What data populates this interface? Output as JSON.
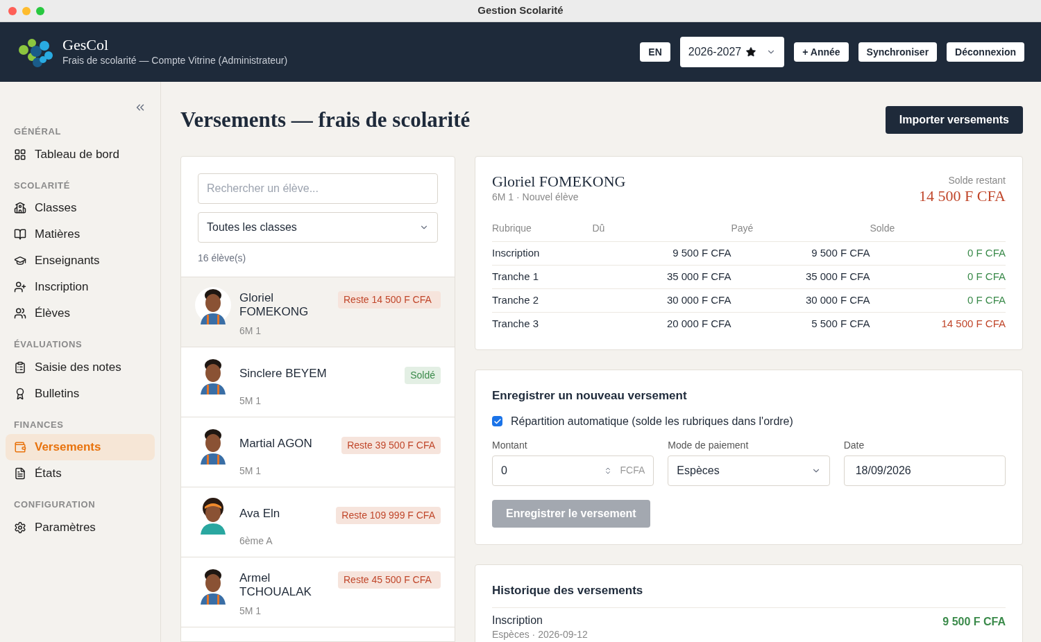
{
  "window": {
    "title": "Gestion Scolarité"
  },
  "header": {
    "app_name": "GesCol",
    "subtitle": "Frais de scolarité — Compte Vitrine (Administrateur)",
    "language": "EN",
    "year": "2026-2027",
    "year_starred": true,
    "buttons": [
      "+ Année",
      "Synchroniser",
      "Déconnexion"
    ]
  },
  "sidebar": {
    "sections": [
      {
        "title": "GÉNÉRAL",
        "items": [
          {
            "label": "Tableau de bord",
            "selected": false
          }
        ]
      },
      {
        "title": "SCOLARITÉ",
        "items": [
          {
            "label": "Classes",
            "selected": false
          },
          {
            "label": "Matières",
            "selected": false
          },
          {
            "label": "Enseignants",
            "selected": false
          },
          {
            "label": "Inscription",
            "selected": false
          },
          {
            "label": "Élèves",
            "selected": false
          }
        ]
      },
      {
        "title": "ÉVALUATIONS",
        "items": [
          {
            "label": "Saisie des notes",
            "selected": false
          },
          {
            "label": "Bulletins",
            "selected": false
          }
        ]
      },
      {
        "title": "FINANCES",
        "items": [
          {
            "label": "Versements",
            "selected": true
          },
          {
            "label": "États",
            "selected": false
          }
        ]
      },
      {
        "title": "CONFIGURATION",
        "items": [
          {
            "label": "Paramètres",
            "selected": false
          }
        ]
      }
    ]
  },
  "page": {
    "title": "Versements — frais de scolarité",
    "import_button": "Importer versements"
  },
  "students": {
    "search_placeholder": "Rechercher un élève...",
    "class_filter": "Toutes les classes",
    "count": "16 élève(s)",
    "items": [
      {
        "name": "Gloriel FOMEKONG",
        "class": "6M 1",
        "badge": "Reste 14 500 F CFA",
        "settled": false,
        "selected": true,
        "kind": "boy"
      },
      {
        "name": "Sinclere BEYEM",
        "class": "5M 1",
        "badge": "Soldé",
        "settled": true,
        "selected": false,
        "kind": "boy"
      },
      {
        "name": "Martial AGON",
        "class": "5M 1",
        "badge": "Reste 39 500 F CFA",
        "settled": false,
        "selected": false,
        "kind": "boy"
      },
      {
        "name": "Ava Eln",
        "class": "6ème A",
        "badge": "Reste 109 999 F CFA",
        "settled": false,
        "selected": false,
        "kind": "girl"
      },
      {
        "name": "Armel TCHOUALAK",
        "class": "5M 1",
        "badge": "Reste 45 500 F CFA",
        "settled": false,
        "selected": false,
        "kind": "boy"
      }
    ]
  },
  "detail": {
    "name": "Gloriel FOMEKONG",
    "info": "6M 1 · Nouvel élève",
    "balance_label": "Solde restant",
    "balance": "14 500 F CFA",
    "table": {
      "columns": [
        "Rubrique",
        "Dû",
        "Payé",
        "Solde"
      ],
      "rows": [
        {
          "cells": [
            "Inscription",
            "9 500 F CFA",
            "9 500 F CFA",
            "0 F CFA"
          ],
          "settled": true
        },
        {
          "cells": [
            "Tranche 1",
            "35 000 F CFA",
            "35 000 F CFA",
            "0 F CFA"
          ],
          "settled": true
        },
        {
          "cells": [
            "Tranche 2",
            "30 000 F CFA",
            "30 000 F CFA",
            "0 F CFA"
          ],
          "settled": true
        },
        {
          "cells": [
            "Tranche 3",
            "20 000 F CFA",
            "5 500 F CFA",
            "14 500 F CFA"
          ],
          "settled": false
        }
      ]
    }
  },
  "payment_form": {
    "title": "Enregistrer un nouveau versement",
    "auto_split": {
      "label": "Répartition automatique (solde les rubriques dans l'ordre)",
      "checked": true
    },
    "amount": {
      "label": "Montant",
      "value": "0",
      "unit": "FCFA"
    },
    "method": {
      "label": "Mode de paiement",
      "value": "Espèces"
    },
    "date": {
      "label": "Date",
      "value": "18/09/2026"
    },
    "submit": {
      "label": "Enregistrer le versement",
      "disabled": true
    }
  },
  "history": {
    "title": "Historique des versements",
    "items": [
      {
        "label": "Inscription",
        "meta": "Espèces · 2026-09-12",
        "amount": "9 500 F CFA"
      }
    ]
  }
}
